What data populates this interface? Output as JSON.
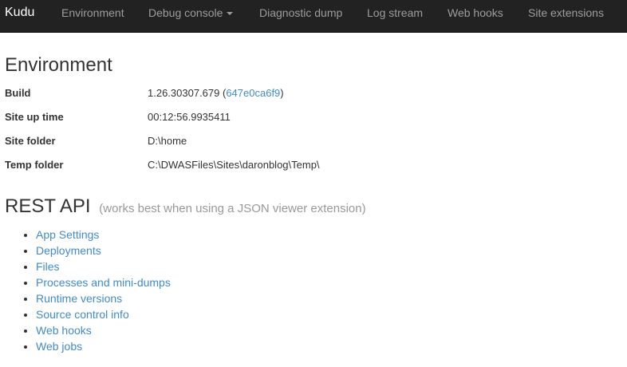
{
  "navbar": {
    "brand": "Kudu",
    "items": [
      {
        "label": "Environment"
      },
      {
        "label": "Debug console"
      },
      {
        "label": "Diagnostic dump"
      },
      {
        "label": "Log stream"
      },
      {
        "label": "Web hooks"
      },
      {
        "label": "Site extensions"
      }
    ]
  },
  "environment": {
    "title": "Environment",
    "build": {
      "label": "Build",
      "version": "1.26.30307.679",
      "commit": "647e0ca6f9"
    },
    "uptime": {
      "label": "Site up time",
      "value": "00:12:56.9935411"
    },
    "site_folder": {
      "label": "Site folder",
      "value": "D:\\home"
    },
    "temp_folder": {
      "label": "Temp folder",
      "value": "C:\\DWASFiles\\Sites\\daronblog\\Temp\\"
    }
  },
  "rest_api": {
    "title": "REST API",
    "subtitle": "(works best when using a JSON viewer extension)",
    "links": [
      {
        "label": "App Settings"
      },
      {
        "label": "Deployments"
      },
      {
        "label": "Files"
      },
      {
        "label": "Processes and mini-dumps"
      },
      {
        "label": "Runtime versions"
      },
      {
        "label": "Source control info"
      },
      {
        "label": "Web hooks"
      },
      {
        "label": "Web jobs"
      }
    ]
  },
  "colors": {
    "navbar_bg": "#222222",
    "nav_text": "#9d9d9d",
    "brand_text": "#ffffff",
    "link": "#428bca",
    "muted": "#999999"
  }
}
